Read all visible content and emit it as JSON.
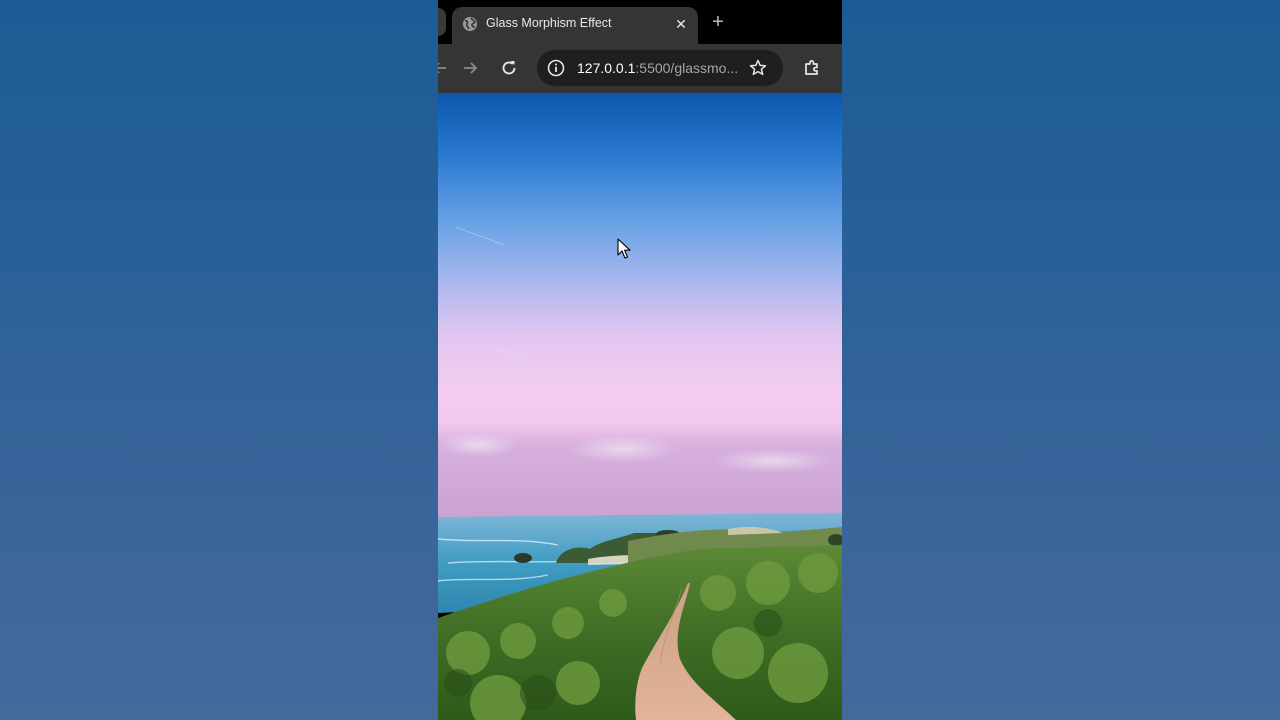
{
  "browser": {
    "tab": {
      "title": "Glass Morphism Effect",
      "favicon": "globe-icon",
      "close_icon": "close-icon"
    },
    "new_tab_icon": "plus-icon",
    "toolbar": {
      "back_icon": "arrow-left-icon",
      "forward_icon": "arrow-right-icon",
      "reload_icon": "reload-icon",
      "site_info_icon": "info-icon",
      "bookmark_icon": "star-icon",
      "extensions_icon": "puzzle-icon"
    },
    "address_bar": {
      "host": "127.0.0.1",
      "rest": ":5500/glassmo..."
    }
  },
  "page": {
    "background_image": "coastal-landscape-photo",
    "cursor_icon": "mouse-pointer-icon"
  },
  "colors": {
    "desktop_bg": "#2b6198",
    "tab_bg": "#353535",
    "tabstrip_bg": "#000000",
    "omnibox_bg": "#1f1f1f",
    "sky_top": "#0a5ab0",
    "sky_pink": "#f0c8ee",
    "sea": "#3d9ac0",
    "grass": "#4a7a2a",
    "path": "#d8ad90"
  }
}
